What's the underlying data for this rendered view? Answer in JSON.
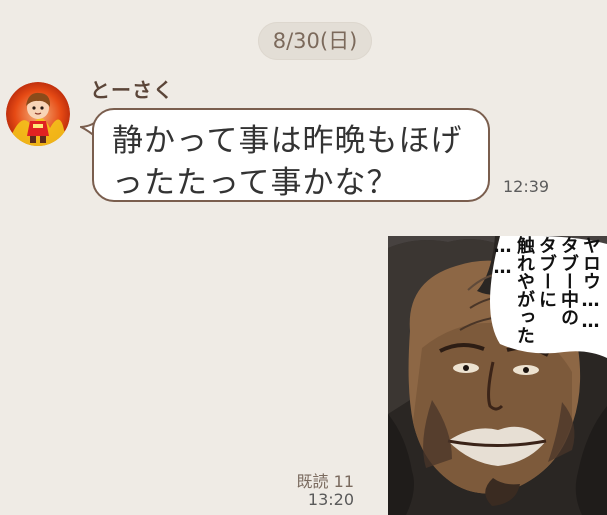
{
  "date_divider": {
    "label": "8/30(日)"
  },
  "incoming_message": {
    "sender": "とーさく",
    "text": "静かって事は昨晩もほげ\nったたって事かな？",
    "time": "12:39"
  },
  "outgoing_sticker": {
    "caption": "ヤロウ……\nタブー中の\nタブーに\n触れやがった\n……",
    "read_status": "既読 11",
    "time": "13:20"
  },
  "colors": {
    "background": "#efebe5",
    "bubble_border": "#7a5e4e",
    "date_chip": "#e3ded6",
    "sender_name": "#5b4538"
  },
  "icons": {
    "avatar": "cartoon-profile-avatar",
    "sticker": "manga-character-sticker"
  }
}
